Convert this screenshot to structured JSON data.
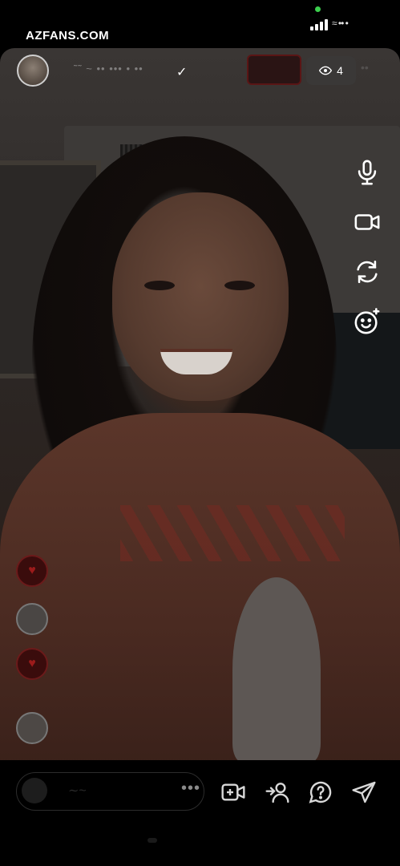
{
  "status_bar": {
    "watermark": "AZFANS.COM",
    "right_text": "≈ •• •"
  },
  "header": {
    "username": "˜˜ ~ •• ••• • ••",
    "verified_mark": "✓",
    "viewer_count": "4",
    "viewer_icon": "eye-icon",
    "close_text": "••"
  },
  "side_tools": [
    {
      "name": "microphone-icon"
    },
    {
      "name": "video-camera-icon"
    },
    {
      "name": "flip-camera-icon"
    },
    {
      "name": "effects-face-icon"
    }
  ],
  "comments_rail": [
    {
      "name": "comment-avatar-1",
      "icon": "♥"
    },
    {
      "name": "comment-avatar-2",
      "icon": ""
    },
    {
      "name": "comment-avatar-3",
      "icon": "♥"
    },
    {
      "name": "comment-avatar-4",
      "icon": ""
    }
  ],
  "bottom_bar": {
    "comment_placeholder": "∼~",
    "more_label": "•••",
    "icons": [
      "add-video-icon",
      "invite-guest-icon",
      "question-icon",
      "send-icon"
    ]
  },
  "colors": {
    "live_badge": "#5a1515",
    "accent_green": "#3ccf4e",
    "background": "#000000"
  }
}
